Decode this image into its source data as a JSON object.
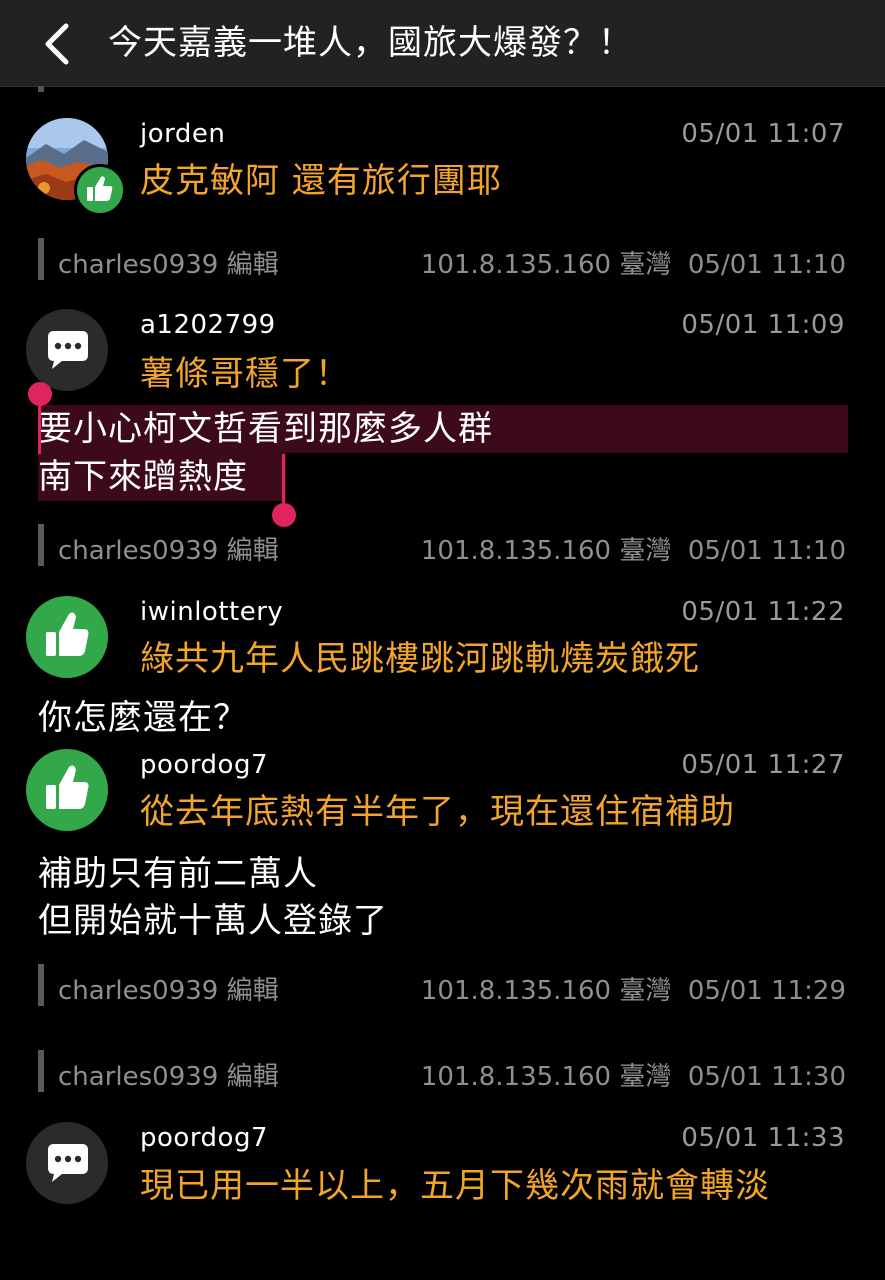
{
  "header": {
    "title": "今天嘉義一堆人，國旅大爆發？！"
  },
  "posts": [
    {
      "user": "jorden",
      "time": "05/01 11:07",
      "text": "皮克敏阿 還有旅行團耶"
    },
    {
      "user": "a1202799",
      "time": "05/01 11:09",
      "text": "薯條哥穩了！"
    },
    {
      "user": "iwinlottery",
      "time": "05/01 11:22",
      "text": "綠共九年人民跳樓跳河跳軌燒炭餓死"
    },
    {
      "user": "poordog7",
      "time": "05/01 11:27",
      "text": "從去年底熱有半年了，現在還住宿補助"
    },
    {
      "user": "poordog7",
      "time": "05/01 11:33",
      "text": "現已用一半以上，五月下幾次雨就會轉淡"
    }
  ],
  "selected_text": [
    "要小心柯文哲看到那麼多人群",
    "南下來蹭熱度"
  ],
  "followups": {
    "iwinlottery": "你怎麼還在？",
    "poordog7": [
      "補助只有前二萬人",
      "但開始就十萬人登錄了"
    ]
  },
  "edits": [
    {
      "user": "charles0939 編輯",
      "ip": "101.8.135.160 臺灣",
      "time": "05/01 11:10"
    },
    {
      "user": "charles0939 編輯",
      "ip": "101.8.135.160 臺灣",
      "time": "05/01 11:10"
    },
    {
      "user": "charles0939 編輯",
      "ip": "101.8.135.160 臺灣",
      "time": "05/01 11:29"
    },
    {
      "user": "charles0939 編輯",
      "ip": "101.8.135.160 臺灣",
      "time": "05/01 11:30"
    }
  ],
  "icons": {
    "back": "chevron-left-icon",
    "like": "thumbs-up-icon",
    "comment": "chat-bubble-icon"
  },
  "colors": {
    "background": "#000000",
    "header": "#222222",
    "comment_text": "#f2a52a",
    "like_green": "#33a84a",
    "selection_handle": "#e0245e",
    "selection_bg": "#3d0a1c"
  }
}
